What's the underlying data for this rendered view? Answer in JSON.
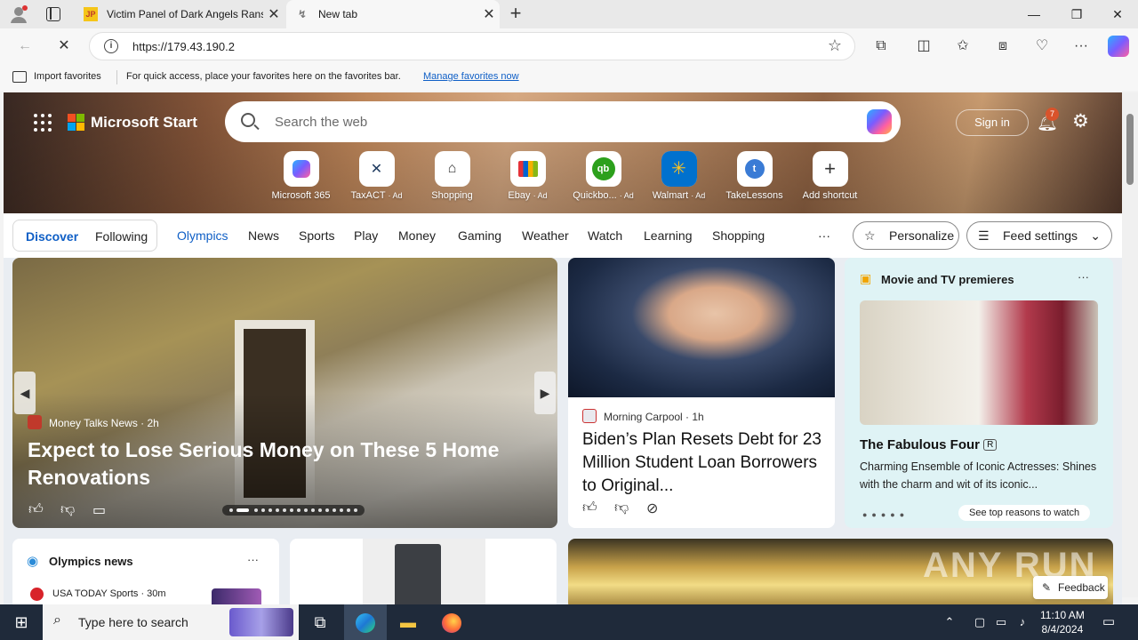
{
  "browser": {
    "tabs": [
      {
        "favicon": "JP",
        "title": "Victim Panel of Dark Angels Rans"
      },
      {
        "favicon": "↯",
        "title": "New tab"
      }
    ],
    "url": "https://179.43.190.2",
    "favorites_bar": {
      "import_label": "Import favorites",
      "message": "For quick access, place your favorites here on the favorites bar.",
      "manage_link": "Manage favorites now"
    }
  },
  "header": {
    "brand": "Microsoft Start",
    "search_placeholder": "Search the web",
    "signin_label": "Sign in",
    "notification_count": "7"
  },
  "shortcuts": [
    {
      "label": "Microsoft 365",
      "ad": "",
      "icon": "microsoft-365-icon"
    },
    {
      "label": "TaxACT",
      "ad": "· Ad",
      "icon": "taxact-icon"
    },
    {
      "label": "Shopping",
      "ad": "",
      "icon": "tag-icon"
    },
    {
      "label": "Ebay",
      "ad": "· Ad",
      "icon": "ebay-bag-icon"
    },
    {
      "label": "Quickbo...",
      "ad": "· Ad",
      "icon": "quickbooks-icon"
    },
    {
      "label": "Walmart",
      "ad": "· Ad",
      "icon": "walmart-icon"
    },
    {
      "label": "TakeLessons",
      "ad": "",
      "icon": "takelessons-icon"
    },
    {
      "label": "Add shortcut",
      "ad": "",
      "icon": "plus-icon"
    }
  ],
  "feed_nav": {
    "discover": "Discover",
    "following": "Following",
    "links": [
      "Olympics",
      "News",
      "Sports",
      "Play",
      "Money",
      "Gaming",
      "Weather",
      "Watch",
      "Learning",
      "Shopping"
    ],
    "more": "···",
    "personalize": "Personalize",
    "feed_settings": "Feed settings"
  },
  "cards": {
    "big": {
      "source": "Money Talks News · 2h",
      "headline": "Expect to Lose Serious Money on These 5 Home Renovations"
    },
    "biden": {
      "source": "Morning Carpool · 1h",
      "headline": "Biden’s Plan Resets Debt for 23 Million Student Loan Borrowers to Original..."
    },
    "movie": {
      "section": "Movie and TV premieres",
      "title": "The Fabulous Four",
      "rating": "R",
      "description": "Charming Ensemble of Iconic Actresses: Shines with the charm and wit of its iconic...",
      "cta": "See top reasons to watch"
    },
    "olympics": {
      "section": "Olympics news",
      "item": "USA TODAY Sports · 30m"
    },
    "feedback": "Feedback",
    "watermark": "ANY RUN"
  },
  "taskbar": {
    "search_placeholder": "Type here to search",
    "time": "11:10 AM",
    "date": "8/4/2024"
  }
}
